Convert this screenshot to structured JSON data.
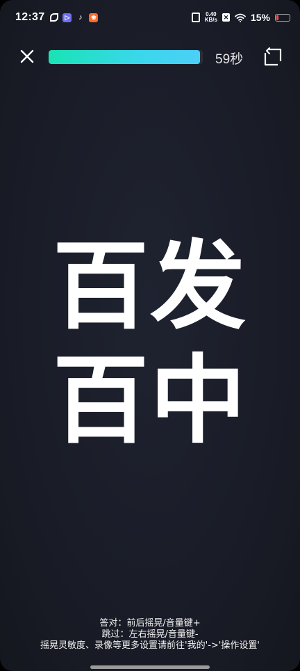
{
  "status_bar": {
    "time": "12:37",
    "app_icons": [
      "leaf-icon",
      "play-icon",
      "tiktok-icon",
      "red-app-icon"
    ],
    "net_speed_value": "0.40",
    "net_speed_unit": "KB/s",
    "battery_percent": "15%",
    "battery_level": 0.15
  },
  "game": {
    "progress": 0.98,
    "timer": "59秒",
    "word_line1": "百发",
    "word_line2": "百中",
    "hint_correct": "答对：前后摇晃/音量键+",
    "hint_skip": "跳过：左右摇晃/音量键-",
    "hint_settings": "摇晃灵敏度、录像等更多设置请前往'我的'->'操作设置'"
  },
  "colors": {
    "background": "#1a1d28",
    "progress_start": "#19e3b4",
    "progress_end": "#4ccff7",
    "battery_low": "#ff4d4d"
  }
}
